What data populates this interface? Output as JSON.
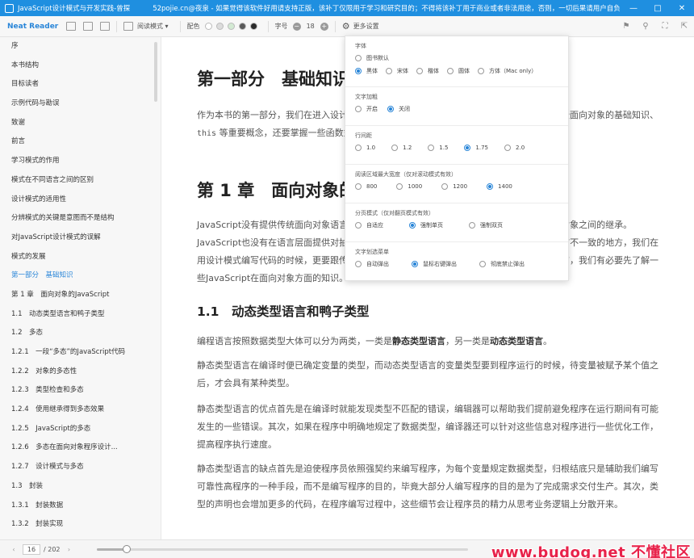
{
  "titlebar": {
    "title": "JavaScript设计模式与开发实践-曾探",
    "notice": "52pojie.cn@夜泉 - 如果觉得该软件好用请支持正版，该补丁仅限用于学习和研究目的；不得将该补丁用于商业或者非法用途，否则，一切后果请用户自负!"
  },
  "toolbar": {
    "brand": "Neat Reader",
    "reading_mode": "阅读模式",
    "color_label": "配色",
    "colors": [
      "#ffffff",
      "#dcdcdc",
      "#d3ead3",
      "#5a5a5a",
      "#2b2b2b"
    ],
    "font_size_label": "字号",
    "font_size": "18",
    "minus": "−",
    "plus": "+",
    "more_settings": "更多设置"
  },
  "sidebar": {
    "items": [
      "序",
      "本书结构",
      "目标读者",
      "示例代码与勘误",
      "致谢",
      "前言",
      "学习模式的作用",
      "模式在不同语言之间的区别",
      "设计模式的适用性",
      "分辨模式的关键是意图而不是结构",
      "对JavaScript设计模式的误解",
      "模式的发展",
      "第一部分　基础知识",
      "第 1 章　面向对象的JavaScript",
      "1.1　动态类型语言和鸭子类型",
      "1.2　多态",
      "1.2.1　一段“多态”的JavaScript代码",
      "1.2.2　对象的多态性",
      "1.2.3　类型检查和多态",
      "1.2.4　使用继承得到多态效果",
      "1.2.5　JavaScript的多态",
      "1.2.6　多态在面向对象程序设计...",
      "1.2.7　设计模式与多态",
      "1.3　封装",
      "1.3.1　封装数据",
      "1.3.2　封装实现"
    ],
    "active_index": 12
  },
  "content": {
    "part_title": "第一部分　基础知识",
    "para1a": "作为本书的第一部分，我们在进入设计模式的学习之前，需要先了解一些相关的知识，例如一些面向对象的基础知识、",
    "para1_code": "this",
    "para1b": " 等重要概念，还要掌握一些函数式编程的技巧。这些都是学习设计模式的必要铺垫。",
    "chapter_title": "第 1 章　面向对象的JavaScript",
    "para2": "JavaScript没有提供传统面向对象语言中的类式继承，而是通过原型委托的方式来实现对象与对象之间的继承。JavaScript也没有在语言层面提供对抽象类和接口的支持。正因为存在这些跟传统面向对象语言不一致的地方，我们在用设计模式编写代码的时候，更要跟传统面向对象语言加以区别。所以在正式学习设计模式之前，我们有必要先了解一些JavaScript在面向对象方面的知识。",
    "section_title": "1.1　动态类型语言和鸭子类型",
    "para3a": "编程语言按照数据类型大体可以分为两类，一类是",
    "para3_b1": "静态类型语言",
    "para3b": "，另一类是",
    "para3_b2": "动态类型语言",
    "para3c": "。",
    "para4": "静态类型语言在编译时便已确定变量的类型，而动态类型语言的变量类型要到程序运行的时候，待变量被赋予某个值之后，才会具有某种类型。",
    "para5": "静态类型语言的优点首先是在编译时就能发现类型不匹配的错误，编辑器可以帮助我们提前避免程序在运行期间有可能发生的一些错误。其次，如果在程序中明确地规定了数据类型，编译器还可以针对这些信息对程序进行一些优化工作，提高程序执行速度。",
    "para6": "静态类型语言的缺点首先是迫使程序员依照强契约来编写程序，为每个变量规定数据类型，归根结底只是辅助我们编写可靠性高程序的一种手段，而不是编写程序的目的，毕竟大部分人编写程序的目的是为了完成需求交付生产。其次，类型的声明也会增加更多的代码，在程序编写过程中，这些细节会让程序员的精力从思考业务逻辑上分散开来。"
  },
  "settings": {
    "font": {
      "title": "字体",
      "row1": [
        {
          "label": "图书默认",
          "checked": false
        }
      ],
      "row2": [
        {
          "label": "黑体",
          "checked": true
        },
        {
          "label": "宋体",
          "checked": false
        },
        {
          "label": "楷体",
          "checked": false
        },
        {
          "label": "圆体",
          "checked": false
        },
        {
          "label": "方体（Mac only）",
          "checked": false
        }
      ]
    },
    "bold": {
      "title": "文字加粗",
      "options": [
        {
          "label": "开启",
          "checked": false
        },
        {
          "label": "关闭",
          "checked": true
        }
      ]
    },
    "line_height": {
      "title": "行间距",
      "options": [
        {
          "label": "1.0",
          "checked": false
        },
        {
          "label": "1.2",
          "checked": false
        },
        {
          "label": "1.5",
          "checked": false
        },
        {
          "label": "1.75",
          "checked": true
        },
        {
          "label": "2.0",
          "checked": false
        }
      ]
    },
    "max_width": {
      "title": "阅读区域最大宽度（仅对滚动模式有效）",
      "options": [
        {
          "label": "800",
          "checked": false
        },
        {
          "label": "1000",
          "checked": false
        },
        {
          "label": "1200",
          "checked": false
        },
        {
          "label": "1400",
          "checked": true
        }
      ]
    },
    "paging": {
      "title": "分页模式（仅对翻页模式有效）",
      "options": [
        {
          "label": "自适应",
          "checked": false
        },
        {
          "label": "强制单页",
          "checked": true
        },
        {
          "label": "强制双页",
          "checked": false
        }
      ]
    },
    "menu": {
      "title": "文字划选菜单",
      "options": [
        {
          "label": "自动弹出",
          "checked": false
        },
        {
          "label": "鼠标右键弹出",
          "checked": true
        },
        {
          "label": "彻底禁止弹出",
          "checked": false
        }
      ]
    }
  },
  "statusbar": {
    "current_page": "16",
    "total_pages": "/ 202",
    "progress": 0.08
  },
  "watermark": "www.budog.net 不懂社区"
}
